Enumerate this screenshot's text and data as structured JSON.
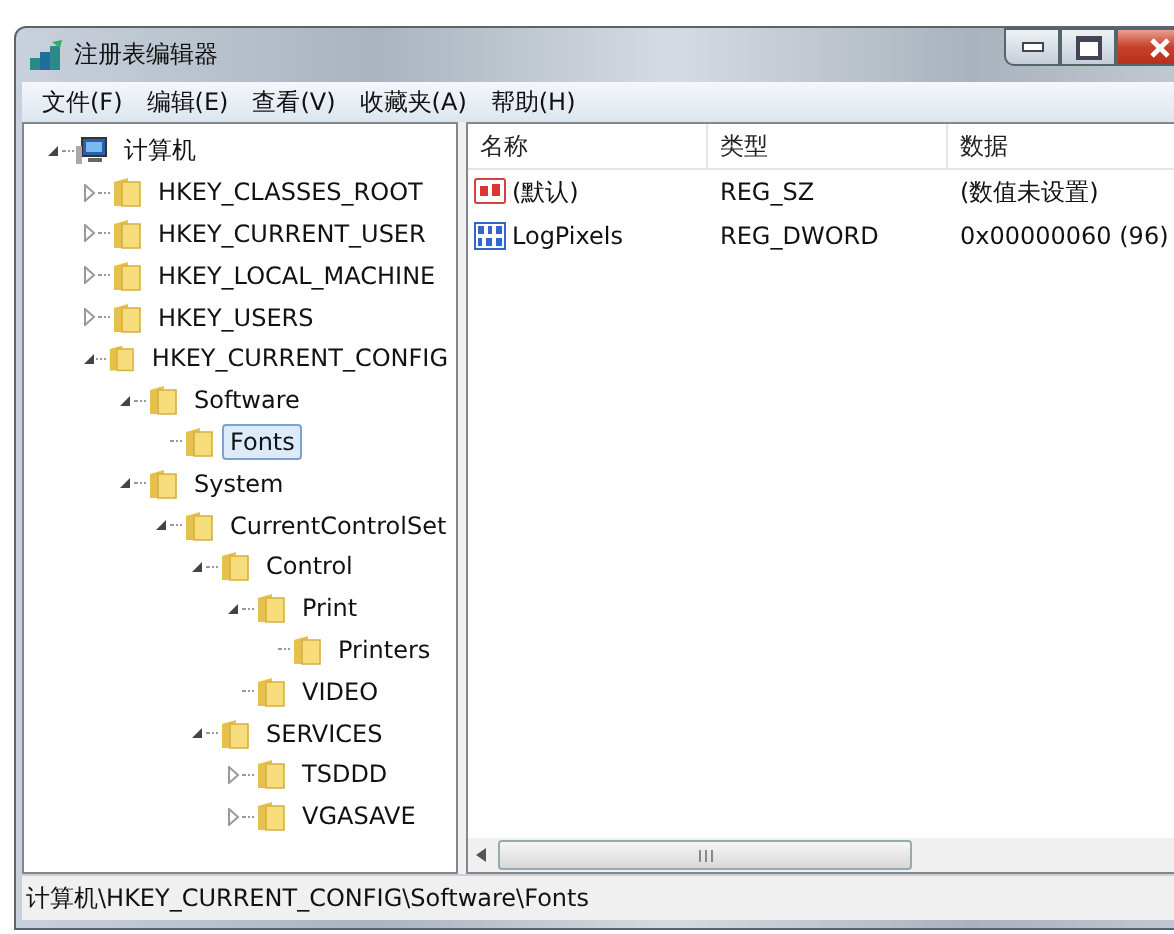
{
  "window": {
    "title": "注册表编辑器"
  },
  "menu": [
    "文件(F)",
    "编辑(E)",
    "查看(V)",
    "收藏夹(A)",
    "帮助(H)"
  ],
  "tree": [
    {
      "label": "计算机",
      "kind": "computer",
      "expanded": true,
      "selected": false,
      "children": [
        {
          "label": "HKEY_CLASSES_ROOT",
          "kind": "folder",
          "expanded": false,
          "selected": false
        },
        {
          "label": "HKEY_CURRENT_USER",
          "kind": "folder",
          "expanded": false,
          "selected": false
        },
        {
          "label": "HKEY_LOCAL_MACHINE",
          "kind": "folder",
          "expanded": false,
          "selected": false
        },
        {
          "label": "HKEY_USERS",
          "kind": "folder",
          "expanded": false,
          "selected": false
        },
        {
          "label": "HKEY_CURRENT_CONFIG",
          "kind": "folder",
          "expanded": true,
          "selected": false,
          "children": [
            {
              "label": "Software",
              "kind": "folder",
              "expanded": true,
              "selected": false,
              "children": [
                {
                  "label": "Fonts",
                  "kind": "folder",
                  "selected": true
                }
              ]
            },
            {
              "label": "System",
              "kind": "folder",
              "expanded": true,
              "selected": false,
              "children": [
                {
                  "label": "CurrentControlSet",
                  "kind": "folder",
                  "expanded": true,
                  "selected": false,
                  "children": [
                    {
                      "label": "Control",
                      "kind": "folder",
                      "expanded": true,
                      "selected": false,
                      "children": [
                        {
                          "label": "Print",
                          "kind": "folder",
                          "expanded": true,
                          "selected": false,
                          "children": [
                            {
                              "label": "Printers",
                              "kind": "folder",
                              "selected": false
                            }
                          ]
                        },
                        {
                          "label": "VIDEO",
                          "kind": "folder",
                          "selected": false
                        }
                      ]
                    },
                    {
                      "label": "SERVICES",
                      "kind": "folder",
                      "expanded": true,
                      "selected": false,
                      "children": [
                        {
                          "label": "TSDDD",
                          "kind": "folder",
                          "expanded": false,
                          "selected": false
                        },
                        {
                          "label": "VGASAVE",
                          "kind": "folder",
                          "expanded": false,
                          "selected": false
                        }
                      ]
                    }
                  ]
                }
              ]
            }
          ]
        }
      ]
    }
  ],
  "table": {
    "columns": [
      "名称",
      "类型",
      "数据"
    ],
    "rows": [
      {
        "kind": "string",
        "cells": [
          "(默认)",
          "REG_SZ",
          "(数值未设置)"
        ]
      },
      {
        "kind": "binary",
        "cells": [
          "LogPixels",
          "REG_DWORD",
          "0x00000060 (96)"
        ]
      }
    ]
  },
  "status_bar": "计算机\\HKEY_CURRENT_CONFIG\\Software\\Fonts"
}
